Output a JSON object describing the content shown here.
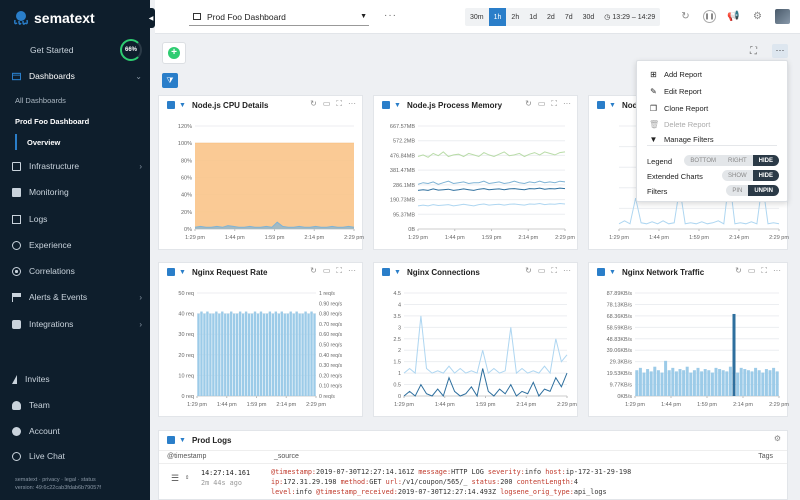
{
  "brand": {
    "name": "sematext"
  },
  "sidebar": {
    "get_started": "Get Started",
    "progress": "66%",
    "items": [
      {
        "label": "Dashboards"
      },
      {
        "label": "Infrastructure"
      },
      {
        "label": "Monitoring"
      },
      {
        "label": "Logs"
      },
      {
        "label": "Experience"
      },
      {
        "label": "Correlations"
      },
      {
        "label": "Alerts & Events"
      },
      {
        "label": "Integrations"
      }
    ],
    "sub_items": {
      "all": "All Dashboards",
      "current": "Prod Foo Dashboard",
      "overview": "Overview"
    },
    "bottom": [
      {
        "label": "Invites"
      },
      {
        "label": "Team"
      },
      {
        "label": "Account"
      },
      {
        "label": "Live Chat"
      }
    ],
    "footer_links": "sematext · privacy · legal · status",
    "version": "version: 49:6c22cab3fdab6b79057f"
  },
  "topbar": {
    "dashboard": "Prod Foo Dashboard",
    "time_buttons": [
      "30m",
      "1h",
      "2h",
      "1d",
      "2d",
      "7d",
      "30d"
    ],
    "active_time": "1h",
    "time_range": "13:29 – 14:29"
  },
  "menu": {
    "items": [
      "Add Report",
      "Edit Report",
      "Clone Report",
      "Delete Report",
      "Manage Filters"
    ],
    "legend": {
      "label": "Legend",
      "options": [
        "BOTTOM",
        "RIGHT",
        "HIDE"
      ],
      "selected": "HIDE"
    },
    "extended": {
      "label": "Extended Charts",
      "options": [
        "SHOW",
        "HIDE"
      ],
      "selected": "HIDE"
    },
    "filters": {
      "label": "Filters",
      "options": [
        "PIN",
        "UNPIN"
      ],
      "selected": "UNPIN"
    }
  },
  "panels": {
    "cpu": {
      "title": "Node.js CPU Details"
    },
    "mem": {
      "title": "Node.js Process Memory"
    },
    "third": {
      "title": "Nod"
    },
    "req": {
      "title": "Nginx Request Rate"
    },
    "conn": {
      "title": "Nginx Connections"
    },
    "traffic": {
      "title": "Nginx Network Traffic"
    }
  },
  "logs": {
    "title": "Prod Logs",
    "col_timestamp": "@timestamp",
    "col_source": "_source",
    "col_tags": "Tags",
    "row": {
      "time": "14:27:14.161",
      "ago": "2m 44s ago",
      "line1_parts": [
        {
          "k": "@timestamp:",
          "v": "2019-07-30T12:27:14.161Z"
        },
        {
          "k": "message:",
          "v": "HTTP LOG"
        },
        {
          "k": "severity:",
          "v": "info"
        },
        {
          "k": "host:",
          "v": "ip-172-31-29-198"
        }
      ],
      "line2_parts": [
        {
          "k": "ip:",
          "v": "172.31.29.198"
        },
        {
          "k": "method:",
          "v": "GET"
        },
        {
          "k": "url:",
          "v": "/v1/coupon/565/_"
        },
        {
          "k": "status:",
          "v": "200"
        },
        {
          "k": "contentLength:",
          "v": "4"
        }
      ],
      "line3_parts": [
        {
          "k": "level:",
          "v": "info"
        },
        {
          "k": "@timestamp_received:",
          "v": "2019-07-30T12:27:14.493Z"
        },
        {
          "k": "logsene_orig_type:",
          "v": "api_logs"
        }
      ]
    }
  },
  "chart_data": [
    {
      "type": "area",
      "name_key": "cpu",
      "x_ticks": [
        "1:29 pm",
        "1:44 pm",
        "1:59 pm",
        "2:14 pm",
        "2:29 pm"
      ],
      "y_ticks": [
        "0%",
        "20%",
        "40%",
        "60%",
        "80%",
        "100%",
        "120%"
      ],
      "ylim": [
        0,
        120
      ],
      "series": [
        {
          "color": "#f9c48a",
          "values": [
            100,
            100,
            100,
            100,
            100,
            100,
            100,
            100,
            100,
            100,
            100,
            100,
            100,
            100,
            100,
            100,
            100,
            100,
            100,
            100,
            100,
            100,
            100,
            100,
            100,
            100,
            100,
            100,
            100,
            100
          ]
        },
        {
          "color": "#7fb3d5",
          "values": [
            2,
            3,
            2,
            2,
            3,
            2,
            4,
            3,
            2,
            2,
            3,
            2,
            2,
            3,
            2,
            8,
            3,
            2,
            2,
            3,
            2,
            2,
            3,
            2,
            2,
            3,
            2,
            2,
            3,
            2
          ]
        }
      ]
    },
    {
      "type": "line",
      "name_key": "mem",
      "x_ticks": [
        "1:29 pm",
        "1:44 pm",
        "1:59 pm",
        "2:14 pm",
        "2:29 pm"
      ],
      "y_ticks": [
        "0B",
        "95.37MB",
        "190.73MB",
        "286.1MB",
        "381.47MB",
        "476.84MB",
        "572.2MB",
        "667.57MB"
      ],
      "ylim": [
        0,
        667.57
      ],
      "series": [
        {
          "color": "#b9dca8",
          "values": [
            470,
            480,
            465,
            490,
            475,
            500,
            470,
            480,
            485,
            470,
            490,
            480,
            470,
            495,
            480,
            470,
            485,
            500,
            475,
            480,
            490,
            470,
            485,
            495,
            480,
            500,
            490,
            480,
            495,
            500
          ]
        },
        {
          "color": "#7fb3d5",
          "values": [
            290,
            300,
            295,
            305,
            290,
            300,
            310,
            295,
            300,
            305,
            295,
            300,
            300,
            310,
            295,
            300,
            305,
            295,
            300,
            310,
            300,
            295,
            305,
            300,
            310,
            300,
            305,
            300,
            310,
            305
          ]
        },
        {
          "color": "#2e6f9e",
          "values": [
            250,
            255,
            250,
            260,
            252,
            255,
            258,
            250,
            255,
            260,
            255,
            250,
            258,
            262,
            255,
            258,
            260,
            255,
            260,
            262,
            258,
            255,
            262,
            260,
            265,
            258,
            262,
            260,
            265,
            262
          ]
        },
        {
          "color": "#aed6f1",
          "values": [
            150,
            155,
            150,
            158,
            152,
            155,
            158,
            150,
            155,
            160,
            155,
            150,
            158,
            162,
            155,
            158,
            160,
            155,
            160,
            162,
            158,
            155,
            162,
            160,
            165,
            158,
            162,
            160,
            165,
            162
          ]
        }
      ]
    },
    {
      "type": "line",
      "name_key": "third",
      "x_ticks": [
        "1:29 pm",
        "1:44 pm",
        "1:59 pm",
        "2:14 pm",
        "2:29 pm"
      ],
      "y_ticks": [],
      "ylim": [
        0,
        100
      ],
      "series": [
        {
          "color": "#aed6f1",
          "values": [
            5,
            8,
            5,
            30,
            6,
            5,
            7,
            5,
            8,
            5,
            6,
            40,
            5,
            6,
            5,
            7,
            5,
            6,
            8,
            5,
            50,
            5,
            6,
            5,
            7,
            5,
            45,
            5,
            6,
            5
          ]
        }
      ]
    },
    {
      "type": "bar",
      "name_key": "req",
      "x_ticks": [
        "1:29 pm",
        "1:44 pm",
        "1:59 pm",
        "2:14 pm",
        "2:29 pm"
      ],
      "y_ticks": [
        "0 req",
        "10 req",
        "20 req",
        "30 req",
        "40 req",
        "50 req"
      ],
      "y2_ticks": [
        "0 req/s",
        "0.10 req/s",
        "0.20 req/s",
        "0.30 req/s",
        "0.40 req/s",
        "0.50 req/s",
        "0.60 req/s",
        "0.70 req/s",
        "0.80 req/s",
        "0.90 req/s",
        "1 req/s"
      ],
      "ylim": [
        0,
        50
      ],
      "series": [
        {
          "color": "#9ccbe8",
          "values": [
            40,
            41,
            40,
            41,
            40,
            40,
            41,
            40,
            41,
            40,
            40,
            41,
            40,
            40,
            41,
            40,
            41,
            40,
            40,
            41,
            40,
            41,
            40,
            40,
            41,
            40,
            41,
            40,
            41,
            40,
            40,
            41,
            40,
            41,
            40,
            40,
            41,
            40,
            41,
            40
          ]
        }
      ]
    },
    {
      "type": "line",
      "name_key": "conn",
      "x_ticks": [
        "1:29 pm",
        "1:44 pm",
        "1:59 pm",
        "2:14 pm",
        "2:29 pm"
      ],
      "y_ticks": [
        "0",
        "0.5",
        "1",
        "1.5",
        "2",
        "2.5",
        "3",
        "3.5",
        "4",
        "4.5"
      ],
      "ylim": [
        0,
        4.5
      ],
      "series": [
        {
          "color": "#aed6f1",
          "values": [
            1,
            1.2,
            1,
            3.5,
            1.2,
            1,
            1.1,
            1,
            1.3,
            1,
            1.2,
            1,
            1.1,
            1,
            2,
            1,
            1.2,
            1,
            1.1,
            3,
            1,
            1.2,
            1,
            1.1,
            1,
            1.3,
            1,
            2.5,
            1.5,
            1.8
          ]
        },
        {
          "color": "#2e6f9e",
          "values": [
            0,
            0.2,
            0,
            0.5,
            0.1,
            0,
            0.3,
            0,
            0.8,
            0.2,
            0,
            0.1,
            0.4,
            0,
            1.2,
            0.2,
            0,
            0.3,
            0.1,
            0.5,
            0,
            0.2,
            0.1,
            0.6,
            0,
            0.3,
            0.2,
            0.8,
            0.4,
            1
          ]
        }
      ]
    },
    {
      "type": "bar",
      "name_key": "traffic",
      "x_ticks": [
        "1:29 pm",
        "1:44 pm",
        "1:59 pm",
        "2:14 pm",
        "2:29 pm"
      ],
      "y_ticks": [
        "0KB/s",
        "9.77KB/s",
        "19.53KB/s",
        "29.3KB/s",
        "39.06KB/s",
        "48.83KB/s",
        "58.59KB/s",
        "68.36KB/s",
        "78.13KB/s",
        "87.89KB/s"
      ],
      "ylim": [
        0,
        87.89
      ],
      "series": [
        {
          "color": "#9ccbe8",
          "values": [
            22,
            24,
            20,
            23,
            21,
            25,
            22,
            20,
            30,
            22,
            24,
            21,
            23,
            22,
            25,
            20,
            22,
            24,
            21,
            23,
            22,
            20,
            24,
            23,
            22,
            21,
            25,
            22,
            20,
            24,
            23,
            22,
            21,
            24,
            22,
            20,
            23,
            22,
            24,
            21
          ]
        },
        {
          "color": "#2e6f9e",
          "values": [
            0,
            0,
            0,
            0,
            0,
            0,
            0,
            0,
            0,
            0,
            0,
            0,
            0,
            0,
            0,
            0,
            0,
            0,
            0,
            0,
            0,
            0,
            0,
            0,
            0,
            0,
            0,
            70,
            0,
            0,
            0,
            0,
            0,
            0,
            0,
            0,
            0,
            0,
            0,
            0
          ]
        }
      ]
    }
  ]
}
